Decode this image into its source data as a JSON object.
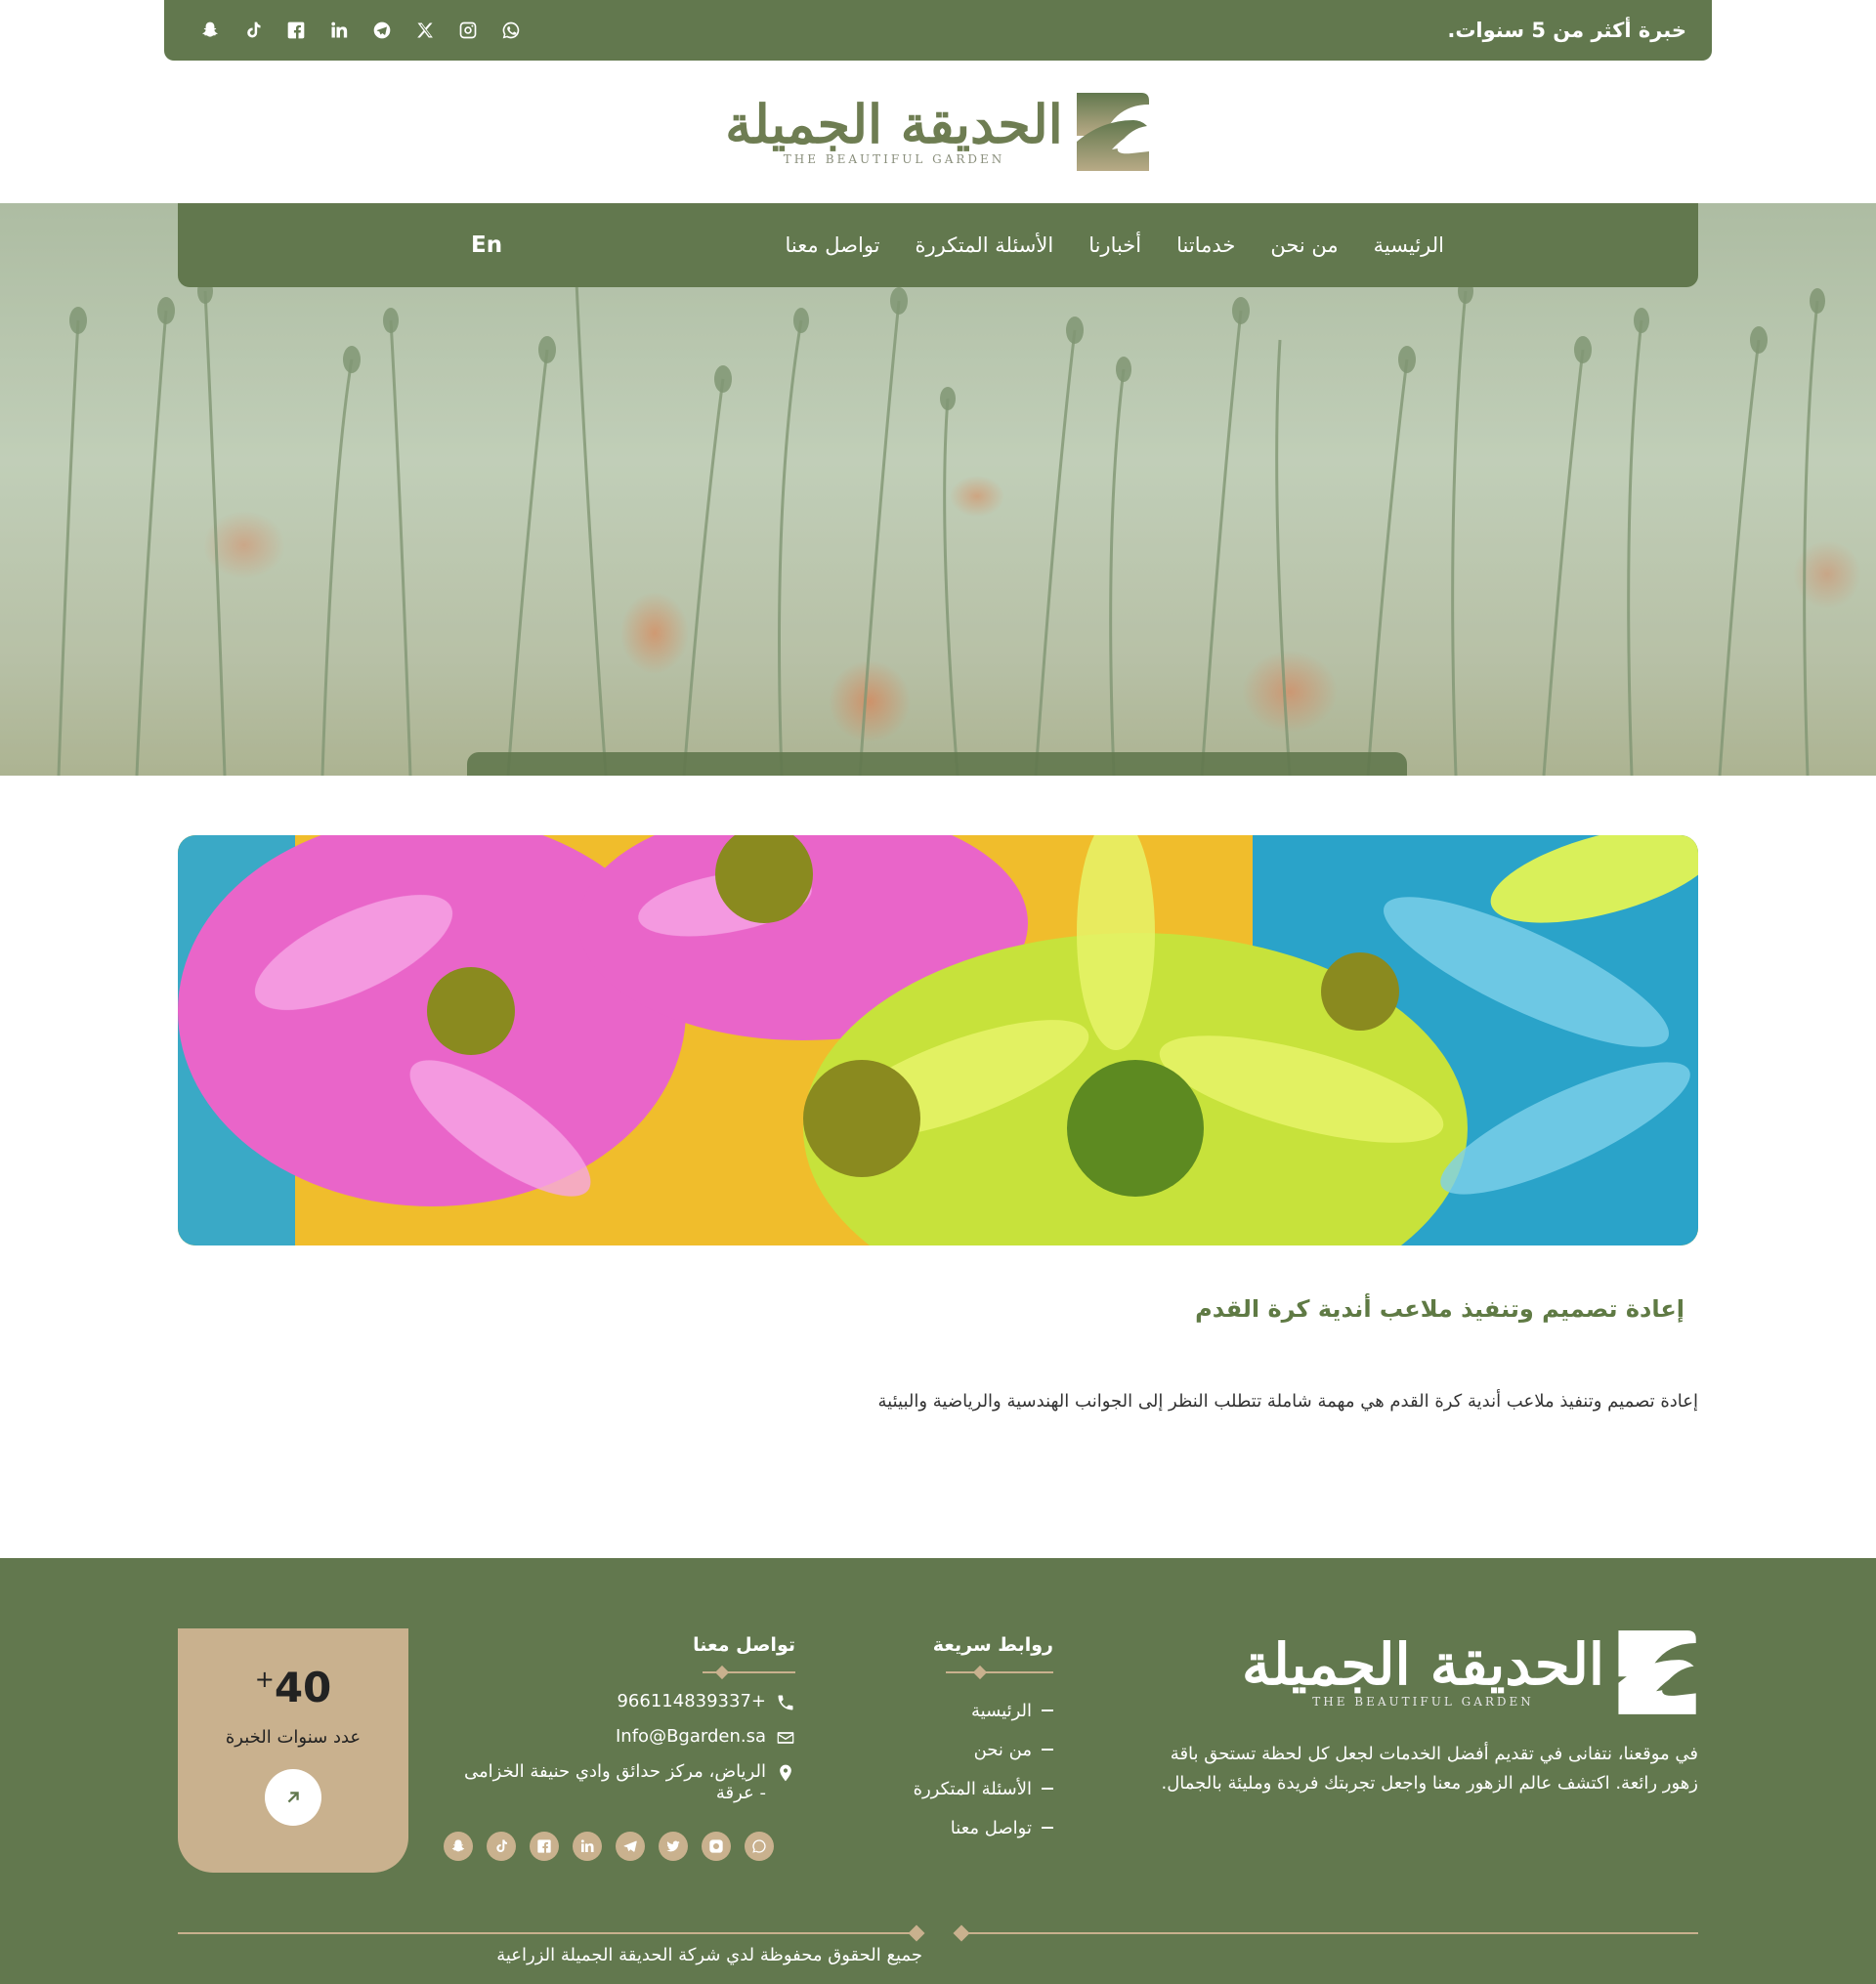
{
  "topbar": {
    "experience_text": "خبرة أكثر من 5 سنوات.",
    "social_icons": [
      "whatsapp-icon",
      "instagram-icon",
      "x-icon",
      "telegram-icon",
      "linkedin-icon",
      "facebook-icon",
      "tiktok-icon",
      "snapchat-icon"
    ]
  },
  "brand": {
    "name_ar": "الحديقة الجميلة",
    "name_en": "THE BEAUTIFUL GARDEN",
    "primary_color": "#62784e",
    "accent_color": "#c9b18e"
  },
  "nav": {
    "items": [
      {
        "label": "الرئيسية"
      },
      {
        "label": "من نحن"
      },
      {
        "label": "خدماتنا"
      },
      {
        "label": "أخبارنا"
      },
      {
        "label": "الأسئلة المتكررة"
      },
      {
        "label": "تواصل معنا"
      }
    ],
    "language_label": "En"
  },
  "article": {
    "title": "إعادة تصميم وتنفيذ ملاعب أندية كرة القدم",
    "body": "إعادة تصميم وتنفيذ ملاعب أندية كرة القدم هي مهمة شاملة تتطلب النظر إلى الجوانب الهندسية والرياضية والبيئية"
  },
  "footer": {
    "about": "في موقعنا، نتفانى في تقديم أفضل الخدمات لجعل كل لحظة تستحق باقة زهور رائعة. اكتشف عالم الزهور معنا واجعل تجربتك فريدة ومليئة بالجمال.",
    "quick_links": {
      "title": "روابط سريعة",
      "items": [
        {
          "label": "الرئيسية"
        },
        {
          "label": "من نحن"
        },
        {
          "label": "الأسئلة المتكررة"
        },
        {
          "label": "تواصل معنا"
        }
      ]
    },
    "contact": {
      "title": "تواصل معنا",
      "phone": "966114839337+",
      "email": "Info@Bgarden.sa",
      "address": "الرياض، مركز حدائق وادي حنيفة الخزامى - عرقة"
    },
    "experience": {
      "number": "40",
      "plus": "+",
      "label": "عدد سنوات الخبرة"
    },
    "copyright": "جميع الحقوق محفوظة لدي شركة الحديقة الجميلة الزراعية"
  }
}
